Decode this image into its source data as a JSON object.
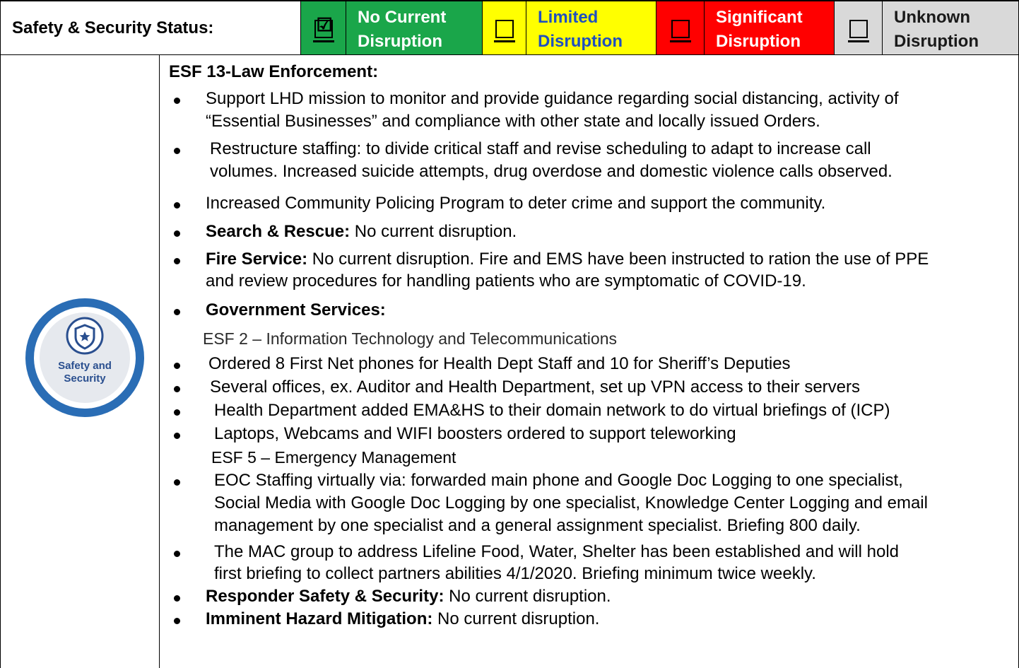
{
  "header": {
    "title": "Safety & Security Status:",
    "statuses": [
      {
        "line1": "No Current",
        "line2": "Disruption",
        "checked": true,
        "color": "#1aa64a"
      },
      {
        "line1": "Limited",
        "line2": "Disruption",
        "checked": false,
        "color": "#ffff00"
      },
      {
        "line1": "Significant",
        "line2": "Disruption",
        "checked": false,
        "color": "#ff0000"
      },
      {
        "line1": "Unknown",
        "line2": "Disruption",
        "checked": false,
        "color": "#d9d9d9"
      }
    ],
    "check_glyph": "☑"
  },
  "badge": {
    "line1": "Safety and",
    "line2": "Security",
    "icon": "shield-star-icon",
    "ring_color": "#2a6db5"
  },
  "content": {
    "section_law": "ESF 13-Law Enforcement:",
    "law1_a": "Support LHD mission to monitor and provide guidance regarding social distancing, activity of",
    "law1_b": "“Essential Businesses” and compliance with other state and locally issued Orders.",
    "law2_a": " Restructure staffing: to divide critical staff and revise scheduling to adapt to increase call",
    "law2_b": " volumes.  Increased suicide attempts, drug overdose and domestic violence calls observed.",
    "law3": "Increased Community Policing Program to deter crime and support the community.",
    "sar_label": "Search & Rescue:",
    "sar_text": " No current disruption.",
    "fire_label": "Fire Service:",
    "fire_text_a": " No current disruption. Fire and EMS have been instructed to ration the use of PPE",
    "fire_text_b": "and review procedures for handling patients who are symptomatic of COVID-19.",
    "gov_label": "Government Services:",
    "esf2_title": "ESF 2 – Information Technology and Telecommunications",
    "it1": "Ordered 8 First Net phones for Health Dept Staff and 10 for Sheriff’s Deputies",
    "it2": "Several offices, ex. Auditor and Health Department, set up VPN access to their servers",
    "it3": "Health Department added EMA&HS to their domain network to do virtual briefings of (ICP)",
    "it4": "Laptops, Webcams and WIFI boosters ordered to support teleworking",
    "esf5_title": "ESF 5 – Emergency Management",
    "em1_a": "EOC Staffing virtually via: forwarded main phone and Google Doc Logging to one specialist,",
    "em1_b": "Social Media with Google Doc Logging by one specialist, Knowledge Center Logging and email",
    "em1_c": "management by one specialist and a general assignment specialist. Briefing 800 daily.",
    "em2_a": " The MAC group to address Lifeline Food, Water, Shelter has been established and will hold",
    "em2_b": "first briefing to collect partners abilities 4/1/2020. Briefing minimum twice weekly.",
    "resp_label": "Responder Safety & Security:",
    "resp_text": " No current disruption.",
    "haz_label": "Imminent Hazard Mitigation:",
    "haz_text": " No current disruption."
  }
}
